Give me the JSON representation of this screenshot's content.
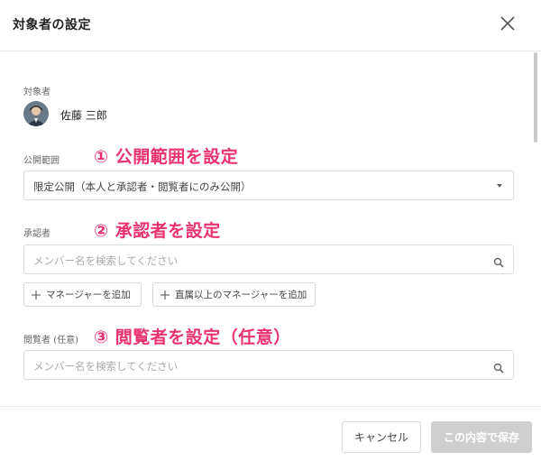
{
  "dialog": {
    "title": "対象者の設定"
  },
  "target": {
    "label": "対象者",
    "name": "佐藤 三郎"
  },
  "scope": {
    "label": "公開範囲",
    "annotation": "① 公開範囲を設定",
    "selected_value": "限定公開（本人と承認者・閲覧者にのみ公開）"
  },
  "approver": {
    "label": "承認者",
    "annotation": "② 承認者を設定",
    "placeholder": "メンバー名を検索してください",
    "add_manager_label": "マネージャーを追加",
    "add_upper_manager_label": "直属以上のマネージャーを追加"
  },
  "viewer": {
    "label": "閲覧者 (任意)",
    "annotation": "③ 閲覧者を設定（任意）",
    "placeholder": "メンバー名を検索してください"
  },
  "footer": {
    "cancel_label": "キャンセル",
    "save_label": "この内容で保存"
  },
  "colors": {
    "annotation": "#e8336f",
    "save_disabled_bg": "#cfcfcf",
    "border": "#dcdcdc"
  }
}
